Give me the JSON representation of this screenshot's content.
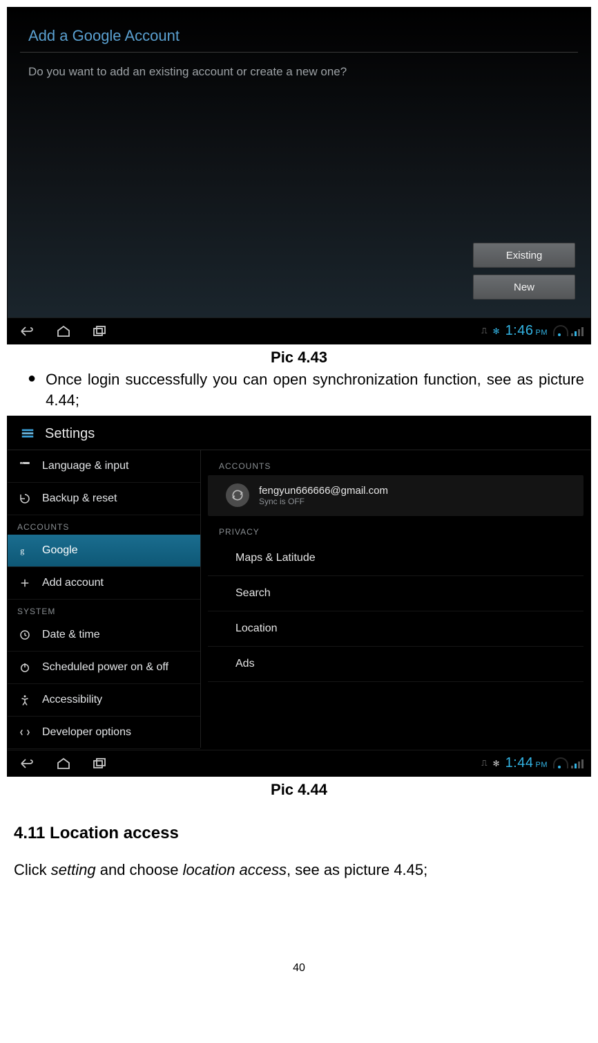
{
  "shot1": {
    "title": "Add a Google Account",
    "prompt": "Do you want to add an existing account or create a new one?",
    "btn_existing": "Existing",
    "btn_new": "New",
    "clock": "1:46",
    "ampm": "PM"
  },
  "caption1": "Pic 4.43",
  "bullet1": "Once login successfully you can open synchronization function, see as picture 4.44;",
  "shot2": {
    "header": "Settings",
    "left": {
      "lang": "Language & input",
      "backup": "Backup & reset",
      "cat_accounts": "ACCOUNTS",
      "google": "Google",
      "add": "Add account",
      "cat_system": "SYSTEM",
      "datetime": "Date & time",
      "sched": "Scheduled power on & off",
      "access": "Accessibility",
      "dev": "Developer options"
    },
    "right": {
      "cat_accounts": "ACCOUNTS",
      "email": "fengyun666666@gmail.com",
      "sync": "Sync is OFF",
      "cat_privacy": "PRIVACY",
      "maps": "Maps & Latitude",
      "search": "Search",
      "location": "Location",
      "ads": "Ads"
    },
    "clock": "1:44",
    "ampm": "PM"
  },
  "caption2": "Pic 4.44",
  "section_heading": "4.11 Location access",
  "para_pre": "Click ",
  "para_it1": "setting",
  "para_mid": " and choose ",
  "para_it2": "location access",
  "para_post": ", see as picture 4.45;",
  "pagenum": "40"
}
